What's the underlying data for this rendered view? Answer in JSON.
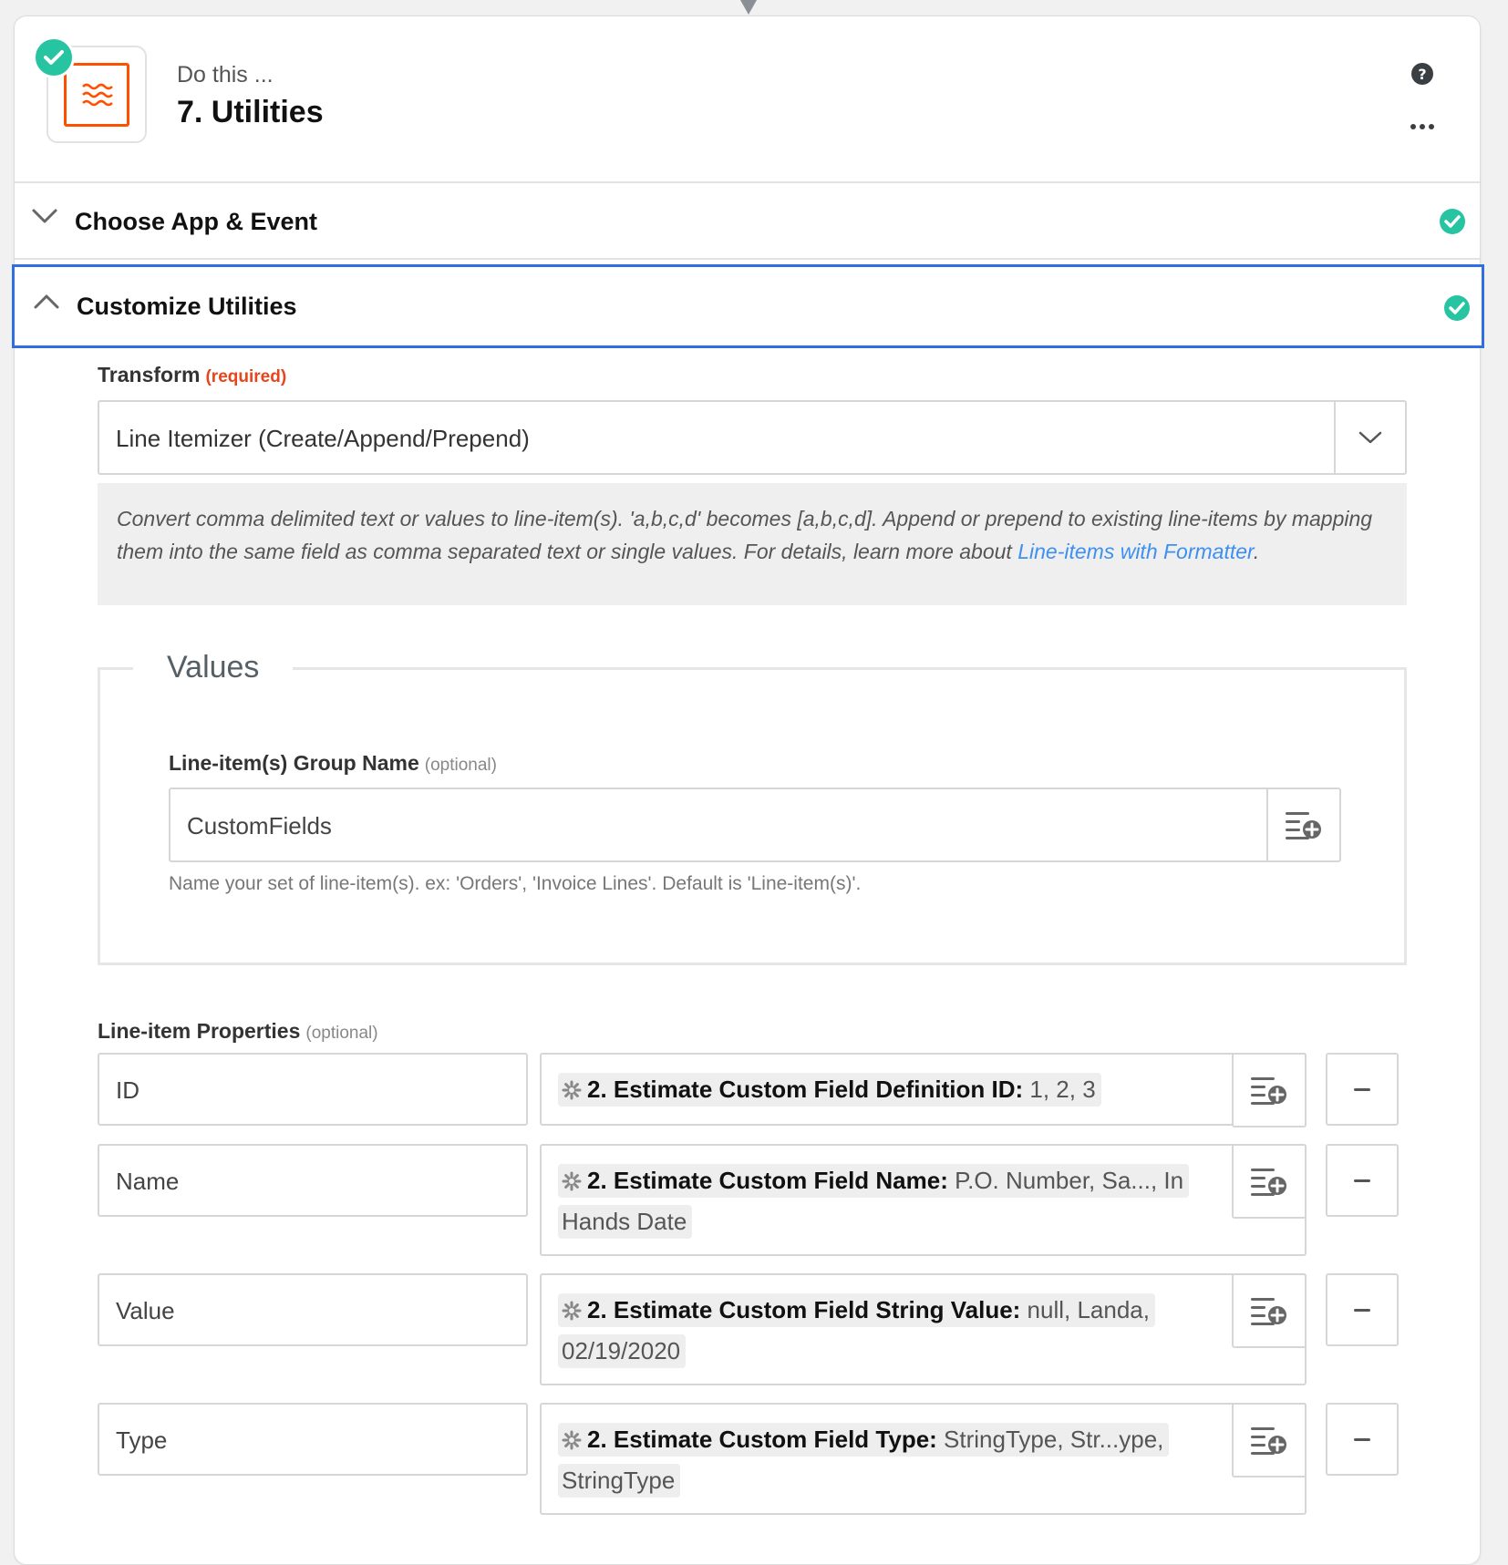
{
  "step": {
    "kicker": "Do this ...",
    "title": "7. Utilities",
    "icons": {
      "app": "formatter-icon",
      "status": "check-icon",
      "help": "help-icon",
      "more": "more-icon"
    }
  },
  "sections": {
    "choose": {
      "label": "Choose App & Event",
      "status": "complete"
    },
    "customize": {
      "label": "Customize Utilities",
      "status": "complete"
    }
  },
  "transform": {
    "label": "Transform",
    "required": "(required)",
    "value": "Line Itemizer (Create/Append/Prepend)",
    "help_text": "Convert comma delimited text or values to line-item(s). 'a,b,c,d' becomes [a,b,c,d]. Append or prepend to existing line-items by mapping them into the same field as comma separated text or single values. For details, learn more about ",
    "help_link": "Line-items with Formatter",
    "help_end": "."
  },
  "values": {
    "legend": "Values",
    "group_name": {
      "label": "Line-item(s) Group Name",
      "optional": "(optional)",
      "value": "CustomFields",
      "hint": "Name your set of line-item(s). ex: 'Orders', 'Invoice Lines'. Default is 'Line-item(s)'."
    }
  },
  "properties": {
    "label": "Line-item Properties",
    "optional": "(optional)",
    "rows": [
      {
        "key": "ID",
        "pill_name": "2. Estimate Custom Field Definition ID:",
        "pill_value": " 1, 2, 3"
      },
      {
        "key": "Name",
        "pill_name": "2. Estimate Custom Field Name:",
        "pill_value": " P.O. Number, Sa..., In Hands Date"
      },
      {
        "key": "Value",
        "pill_name": "2. Estimate Custom Field String Value:",
        "pill_value": " null, Landa, 02/19/2020"
      },
      {
        "key": "Type",
        "pill_name": "2. Estimate Custom Field Type:",
        "pill_value": " StringType, Str...ype, StringType"
      }
    ]
  },
  "colors": {
    "accent": "#ff4f00",
    "success": "#26c4a0",
    "focus": "#2f6fe0",
    "link": "#3d8ff0",
    "required": "#e8451d"
  }
}
